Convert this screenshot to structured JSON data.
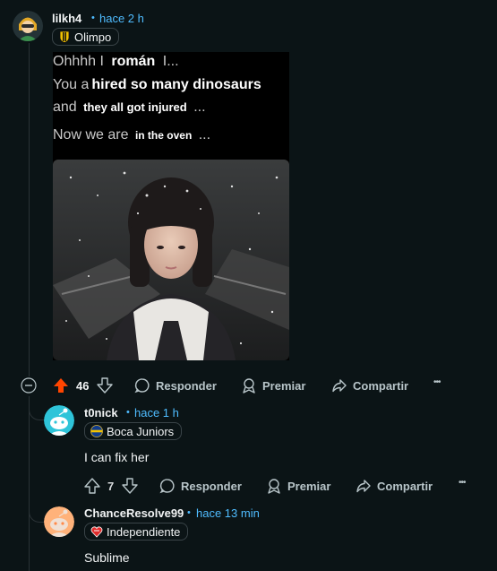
{
  "post": {
    "username": "lilkh4",
    "separator": "•",
    "time": "hace 2 h",
    "flair": "Olimpo",
    "meme": {
      "line1_a": "Ohhhh I",
      "line1_b": "román",
      "line1_c": "I...",
      "line2_a": "You a",
      "line2_b": "hired so many dinosaurs",
      "line3_a": "and",
      "line3_b": "they all got injured",
      "line3_c": "...",
      "line4_a": "Now we are",
      "line4_b": "in the oven",
      "line4_c": "..."
    },
    "votes": "46",
    "reply_label": "Responder",
    "award_label": "Premiar",
    "share_label": "Compartir",
    "more_label": "•••"
  },
  "replies": [
    {
      "username": "t0nick",
      "separator": "•",
      "time": "hace 1 h",
      "flair": "Boca Juniors",
      "text": "I can fix her",
      "votes": "7",
      "reply_label": "Responder",
      "award_label": "Premiar",
      "share_label": "Compartir",
      "more_label": "•••"
    },
    {
      "username": "ChanceResolve99",
      "separator": "•",
      "time": "hace 13 min",
      "flair": "Independiente",
      "text": "Sublime"
    }
  ],
  "colors": {
    "background": "#0b1416",
    "upvote_active": "#ff4500",
    "link_blue": "#4fbcff",
    "text": "#f2f4f5",
    "muted": "#b8c5c9"
  }
}
